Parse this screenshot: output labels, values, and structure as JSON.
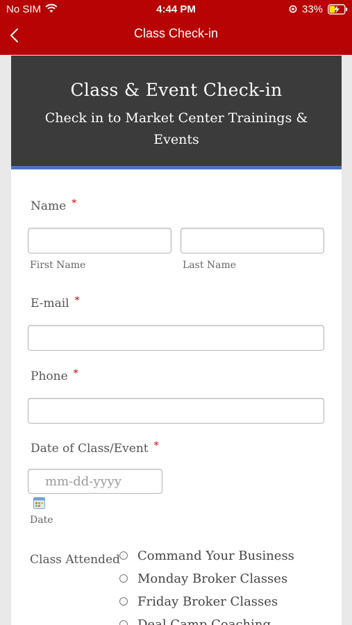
{
  "status_bar": {
    "carrier": "No SIM",
    "time": "4:44 PM",
    "battery_percent": "33%",
    "icons": [
      "wifi-icon",
      "orientation-lock-icon",
      "battery-charging-icon"
    ]
  },
  "nav": {
    "title": "Class Check-in",
    "back_icon": "chevron-left-icon"
  },
  "form": {
    "header_title": "Class & Event Check-in",
    "header_subtitle": "Check in to Market Center Trainings & Events",
    "name": {
      "label": "Name",
      "required_mark": "*",
      "first_sublabel": "First Name",
      "last_sublabel": "Last Name",
      "first_value": "",
      "last_value": ""
    },
    "email": {
      "label": "E-mail",
      "required_mark": "*",
      "value": ""
    },
    "phone": {
      "label": "Phone",
      "required_mark": "*",
      "value": ""
    },
    "date": {
      "label": "Date of Class/Event",
      "required_mark": "*",
      "placeholder": "mm-dd-yyyy",
      "sublabel": "Date",
      "icon": "calendar-icon"
    },
    "class_attended": {
      "label": "Class Attended",
      "options": [
        {
          "label": "Command Your Business",
          "selected": false
        },
        {
          "label": "Monday Broker Classes",
          "selected": false
        },
        {
          "label": "Friday Broker Classes",
          "selected": false
        },
        {
          "label": "Deal Camp Coaching",
          "selected": false
        }
      ]
    }
  },
  "colors": {
    "brand_red": "#b70303",
    "header_dark": "#3b3b3b",
    "accent_blue": "#4c73c0",
    "required_red": "#c90000"
  }
}
